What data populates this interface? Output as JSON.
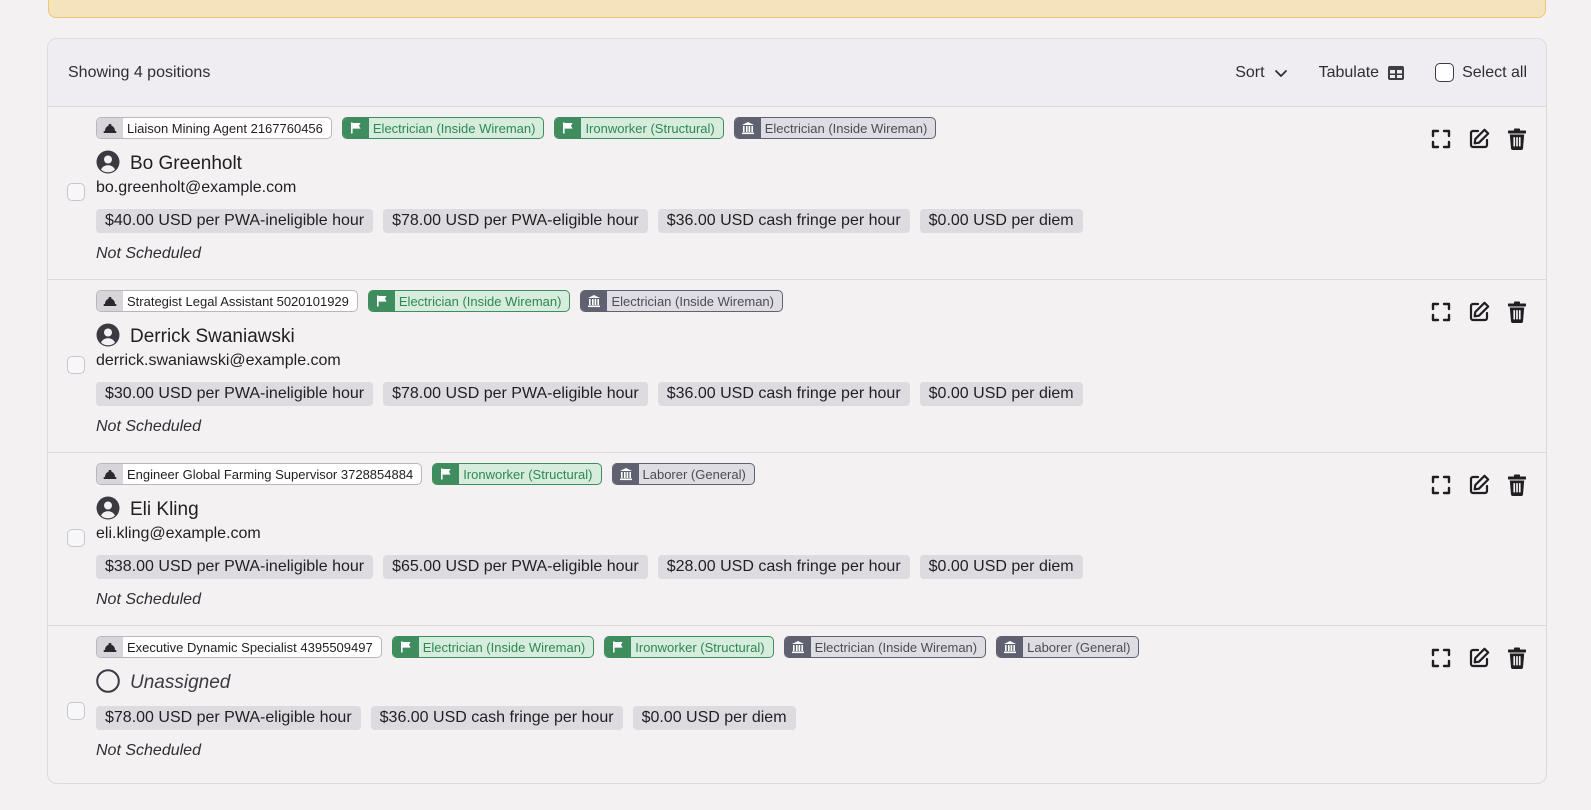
{
  "list": {
    "showing_label": "Showing 4 positions",
    "sort_label": "Sort",
    "tabulate_label": "Tabulate",
    "select_all_label": "Select all"
  },
  "positions": [
    {
      "position": "Liaison Mining Agent 2167760456",
      "crafts": [
        "Electrician (Inside Wireman)",
        "Ironworker (Structural)"
      ],
      "classifications": [
        "Electrician (Inside Wireman)"
      ],
      "worker_name": "Bo Greenholt",
      "email": "bo.greenholt@example.com",
      "rates": [
        "$40.00 USD per PWA-ineligible hour",
        "$78.00 USD per PWA-eligible hour",
        "$36.00 USD cash fringe per hour",
        "$0.00 USD per diem"
      ],
      "schedule": "Not Scheduled"
    },
    {
      "position": "Strategist Legal Assistant 5020101929",
      "crafts": [
        "Electrician (Inside Wireman)"
      ],
      "classifications": [
        "Electrician (Inside Wireman)"
      ],
      "worker_name": "Derrick Swaniawski",
      "email": "derrick.swaniawski@example.com",
      "rates": [
        "$30.00 USD per PWA-ineligible hour",
        "$78.00 USD per PWA-eligible hour",
        "$36.00 USD cash fringe per hour",
        "$0.00 USD per diem"
      ],
      "schedule": "Not Scheduled"
    },
    {
      "position": "Engineer Global Farming Supervisor 3728854884",
      "crafts": [
        "Ironworker (Structural)"
      ],
      "classifications": [
        "Laborer (General)"
      ],
      "worker_name": "Eli Kling",
      "email": "eli.kling@example.com",
      "rates": [
        "$38.00 USD per PWA-ineligible hour",
        "$65.00 USD per PWA-eligible hour",
        "$28.00 USD cash fringe per hour",
        "$0.00 USD per diem"
      ],
      "schedule": "Not Scheduled"
    },
    {
      "position": "Executive Dynamic Specialist 4395509497",
      "crafts": [
        "Electrician (Inside Wireman)",
        "Ironworker (Structural)"
      ],
      "classifications": [
        "Electrician (Inside Wireman)",
        "Laborer (General)"
      ],
      "worker_name": "Unassigned",
      "unassigned": true,
      "email": "",
      "rates": [
        "$78.00 USD per PWA-eligible hour",
        "$36.00 USD cash fringe per hour",
        "$0.00 USD per diem"
      ],
      "schedule": "Not Scheduled"
    }
  ],
  "icons": {
    "position_tag": "hard-hat-icon",
    "craft_tag": "flag-icon",
    "classification_tag": "building-columns-icon",
    "worker": "user-circle-icon",
    "unassigned": "empty-circle-icon",
    "expand": "expand-icon",
    "edit": "edit-icon",
    "delete": "trash-icon"
  },
  "colors": {
    "craft_green": "#3f8c5f",
    "classification_gray": "#5f6170",
    "banner_yellow": "#f5e3bb"
  }
}
